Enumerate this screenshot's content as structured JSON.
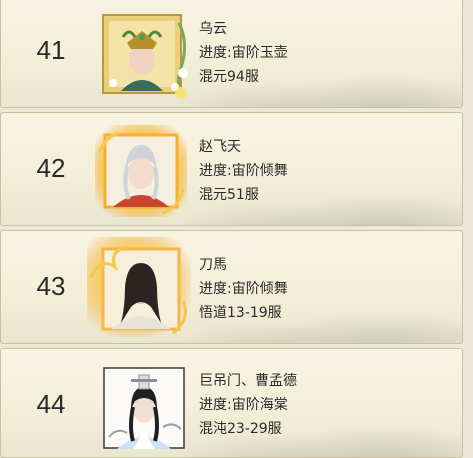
{
  "entries": [
    {
      "rank": "41",
      "name": "乌云",
      "progress": "进度:宙阶玉壶",
      "server": "混元94服",
      "frame": "gold-floral"
    },
    {
      "rank": "42",
      "name": "赵飞天",
      "progress": "进度:宙阶倾舞",
      "server": "混元51服",
      "frame": "flame"
    },
    {
      "rank": "43",
      "name": "刀馬",
      "progress": "进度:宙阶倾舞",
      "server": "悟道13-19服",
      "frame": "flame"
    },
    {
      "rank": "44",
      "name": "巨吊门、曹孟德",
      "progress": "进度:宙阶海棠",
      "server": "混沌23-29服",
      "frame": "plain"
    }
  ],
  "colors": {
    "card_bg": "#f5f1dc",
    "border": "#c8c0a0",
    "text": "#2a2a2a",
    "flame": "#f7b531"
  }
}
